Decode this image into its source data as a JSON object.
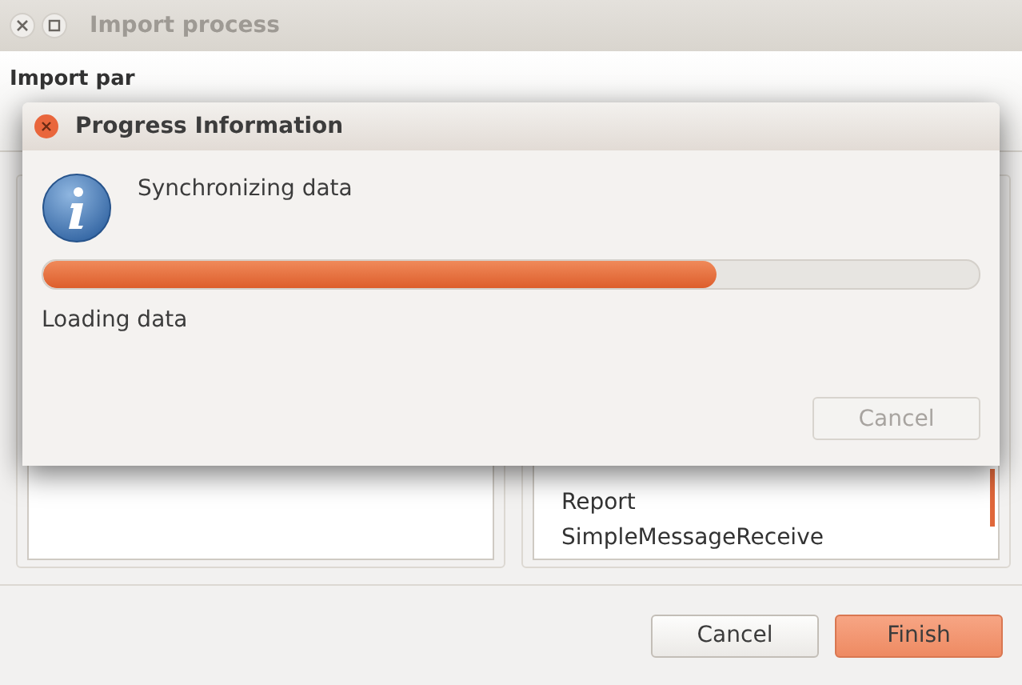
{
  "window": {
    "title": "Import process"
  },
  "header": {
    "title": "Import par"
  },
  "right_list": {
    "items": [
      "Report",
      "SimpleMessageReceive"
    ]
  },
  "buttons": [
    {
      "label": "Cancel",
      "kind": "normal"
    },
    {
      "label": "Finish",
      "kind": "primary"
    }
  ],
  "dialog": {
    "title": "Progress Information",
    "message": "Synchronizing data",
    "progress": {
      "level": 0.72
    },
    "status": "Loading data",
    "button": {
      "label": "Cancel",
      "disabled": true
    }
  }
}
